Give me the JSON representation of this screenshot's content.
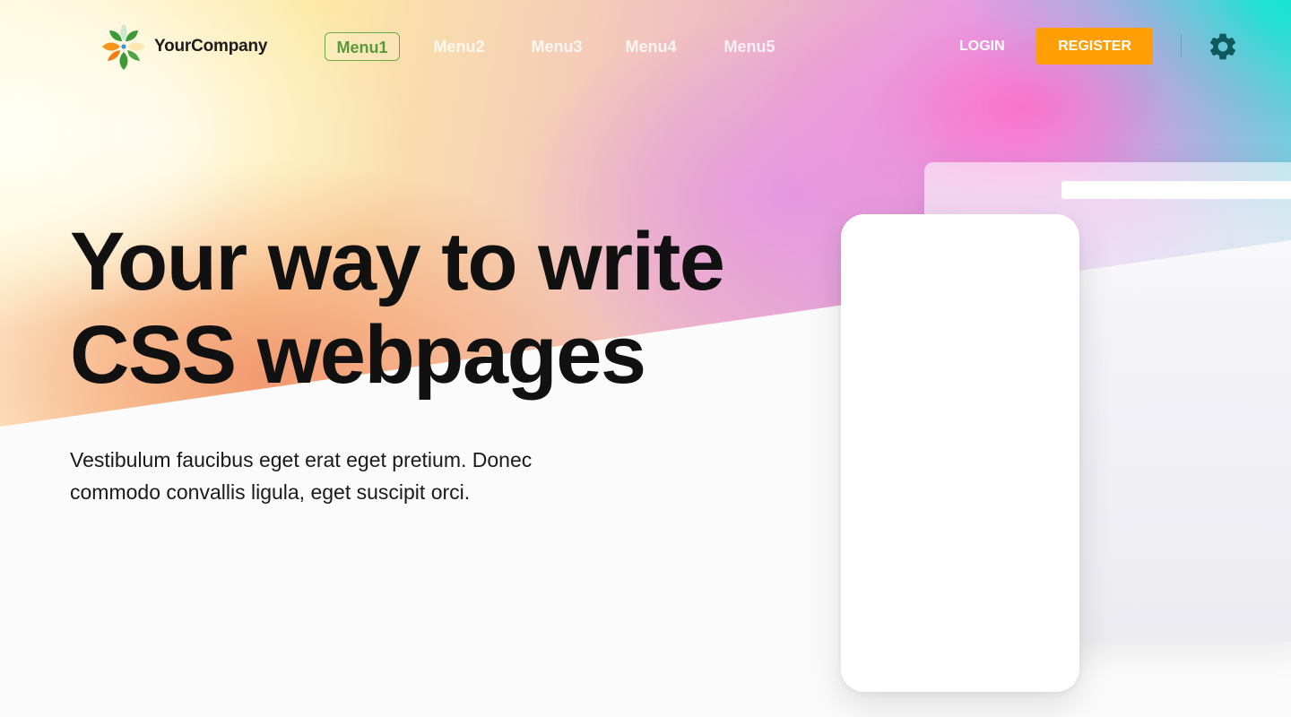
{
  "brand": {
    "name": "YourCompany",
    "logo_icon": "flower-logo-icon"
  },
  "nav": {
    "items": [
      {
        "label": "Menu1",
        "active": true
      },
      {
        "label": "Menu2",
        "active": false
      },
      {
        "label": "Menu3",
        "active": false
      },
      {
        "label": "Menu4",
        "active": false
      },
      {
        "label": "Menu5",
        "active": false
      }
    ],
    "active_color": "#5a9a3c"
  },
  "auth": {
    "login_label": "LOGIN",
    "register_label": "REGISTER",
    "register_color": "#ff9f05"
  },
  "settings": {
    "icon": "gear-icon",
    "color": "#0f5a5a"
  },
  "hero": {
    "title_line1": "Your way to write",
    "title_line2": "CSS webpages",
    "subtitle": "Vestibulum faucibus eget erat eget pretium. Donec commodo convallis ligula, eget suscipit orci."
  }
}
